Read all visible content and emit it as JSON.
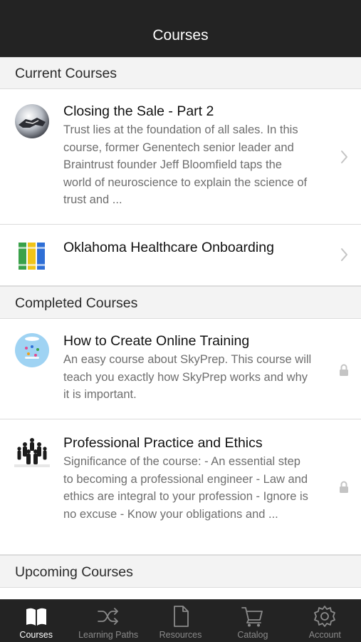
{
  "header": {
    "title": "Courses"
  },
  "sections": {
    "current": {
      "title": "Current Courses",
      "courses": [
        {
          "title": "Closing the Sale - Part 2",
          "description": "Trust lies at the foundation of all sales. In this course, former Genentech senior leader and Braintrust founder Jeff Bloomfield taps the world of neuroscience to explain the science of trust and ...",
          "thumbnail_icon": "handshake-icon",
          "accessory_icon": "chevron-right-icon"
        },
        {
          "title": "Oklahoma Healthcare Onboarding",
          "description": "",
          "thumbnail_icon": "books-icon",
          "accessory_icon": "chevron-right-icon"
        }
      ]
    },
    "completed": {
      "title": "Completed Courses",
      "courses": [
        {
          "title": "How to Create Online Training",
          "description": "An easy course about SkyPrep. This course will teach you exactly how SkyPrep works and why it is important.",
          "thumbnail_icon": "training-bubble-icon",
          "accessory_icon": "lock-icon"
        },
        {
          "title": "Professional Practice and Ethics",
          "description": "Significance of the course:   - An essential step to becoming a professional engineer - Law and ethics are integral to your profession - Ignore is no excuse - Know your obligations and ...",
          "thumbnail_icon": "business-people-icon",
          "accessory_icon": "lock-icon"
        }
      ]
    },
    "upcoming": {
      "title": "Upcoming Courses",
      "courses": []
    }
  },
  "tabbar": {
    "tabs": [
      {
        "label": "Courses",
        "icon": "book-icon",
        "active": true
      },
      {
        "label": "Learning Paths",
        "icon": "shuffle-icon",
        "active": false
      },
      {
        "label": "Resources",
        "icon": "document-icon",
        "active": false
      },
      {
        "label": "Catalog",
        "icon": "cart-icon",
        "active": false
      },
      {
        "label": "Account",
        "icon": "gear-icon",
        "active": false
      }
    ]
  },
  "colors": {
    "bars": "#232323",
    "section_background": "#f3f3f3",
    "active_tab": "#ffffff",
    "inactive_tab": "#8a8a8a",
    "description_text": "#6e6e6e"
  }
}
